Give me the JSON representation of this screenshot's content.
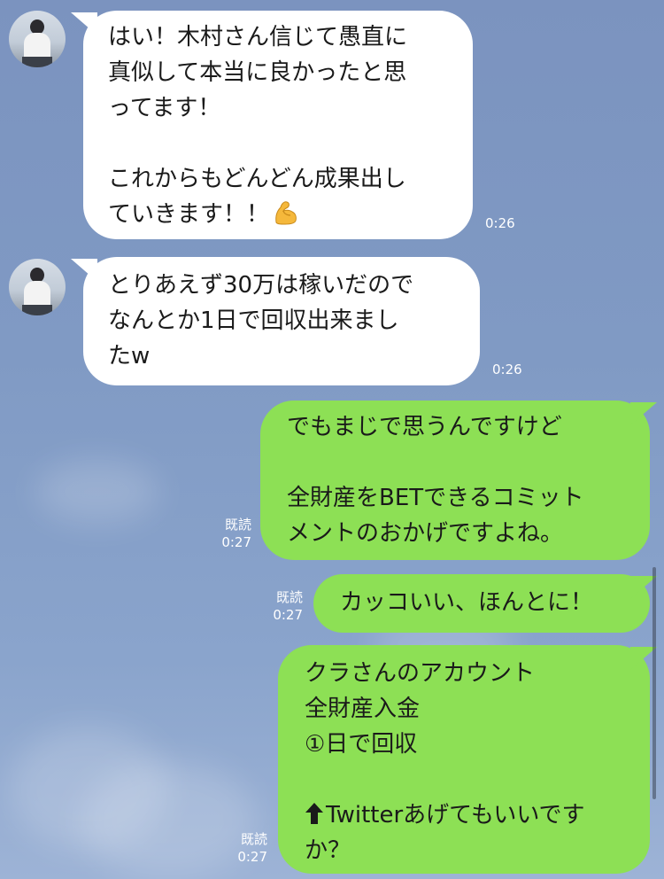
{
  "messages": [
    {
      "side": "left",
      "lines": [
        "はい！木村さん信じて愚直に",
        "真似して本当に良かったと思",
        "ってます！",
        "",
        "これからもどんどん成果出し",
        "ていきます！！"
      ],
      "emoji": "flexed-biceps-icon",
      "time": "0:26"
    },
    {
      "side": "left",
      "lines": [
        "とりあえず30万は稼いだので",
        "なんとか1日で回収出来まし",
        "たw"
      ],
      "time": "0:26"
    },
    {
      "side": "right",
      "lines": [
        "でもまじで思うんですけど",
        "",
        "全財産をBETできるコミット",
        "メントのおかげですよね。"
      ],
      "read": "既読",
      "time": "0:27"
    },
    {
      "side": "right",
      "lines": [
        "カッコいい、ほんとに！"
      ],
      "read": "既読",
      "time": "0:27"
    },
    {
      "side": "right",
      "lines": [
        "クラさんのアカウント",
        "全財産入金",
        "①日で回収",
        "",
        "Twitterあげてもいいです",
        "か？"
      ],
      "icon": "up-arrow-icon",
      "read": "既読",
      "time": "0:27"
    }
  ],
  "colors": {
    "incoming_bubble": "#ffffff",
    "outgoing_bubble": "#8de055",
    "background": "#809ac4",
    "meta_text": "#ffffff"
  }
}
